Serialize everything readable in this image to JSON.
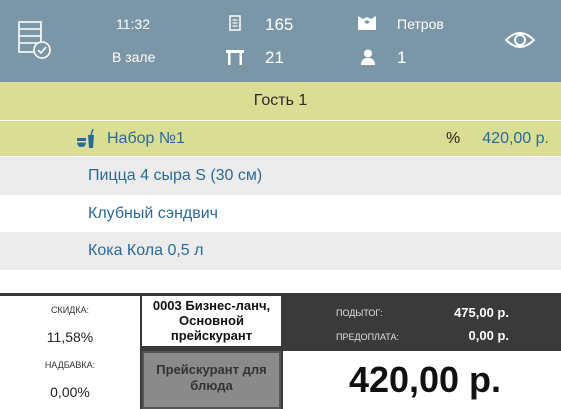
{
  "header": {
    "time": "11:32",
    "location": "В зале",
    "order_number": "165",
    "table_number": "21",
    "waiter": "Петров",
    "guests_count": "1"
  },
  "guest": {
    "title": "Гость 1"
  },
  "order": {
    "set_item": {
      "name": "Набор №1",
      "discount_mark": "%",
      "price": "420,00 р."
    },
    "items": [
      {
        "name": "Пицца 4 сыра S (30 см)"
      },
      {
        "name": "Клубный сэндвич"
      },
      {
        "name": "Кока Кола 0,5 л"
      }
    ]
  },
  "summary": {
    "discount_label": "СКИДКА:",
    "discount_value": "11,58%",
    "markup_label": "НАДБАВКА:",
    "markup_value": "0,00%",
    "price_list_lines": [
      "0003 Бизнес-ланч,",
      "Основной",
      "прейскурант"
    ],
    "price_list_button_lines": [
      "Прейскурант для",
      "блюда"
    ],
    "subtotal_label": "ПОДЫТОГ:",
    "subtotal_value": "475,00 р.",
    "prepayment_label": "ПРЕДОПЛАТА:",
    "prepayment_value": "0,00 р.",
    "total_value": "420,00 р."
  },
  "colors": {
    "header_bg": "#7b96a6",
    "highlight_bg": "#dadd94",
    "item_text": "#2a6a96",
    "row_grey": "#ececec",
    "summary_bg": "#3a3a3a"
  },
  "icons": [
    "order-list-icon",
    "receipt-icon",
    "table-icon",
    "waiter-icon",
    "person-icon",
    "eye-icon",
    "combo-set-icon"
  ]
}
